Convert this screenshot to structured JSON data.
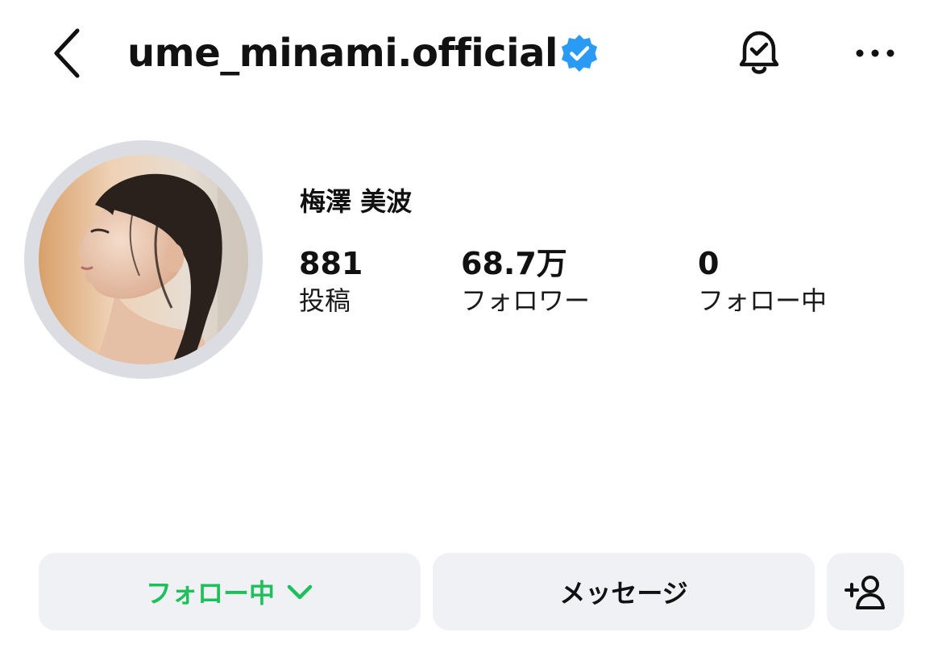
{
  "header": {
    "username": "ume_minami.official",
    "back_icon": "chevron-left-icon",
    "verified_icon": "verified-badge-icon",
    "bell_icon": "bell-check-icon",
    "more_icon": "more-horizontal-icon"
  },
  "profile": {
    "display_name": "梅澤 美波",
    "stats": {
      "posts": {
        "value": "881",
        "label": "投稿"
      },
      "followers": {
        "value": "68.7万",
        "label": "フォロワー"
      },
      "following": {
        "value": "0",
        "label": "フォロー中"
      }
    }
  },
  "actions": {
    "following_label": "フォロー中",
    "message_label": "メッセージ",
    "add_user_icon": "add-user-icon"
  },
  "colors": {
    "verified": "#2a9bf4",
    "following_text": "#1dc05a",
    "button_bg": "#eff1f4",
    "avatar_ring": "#dcdde2"
  }
}
